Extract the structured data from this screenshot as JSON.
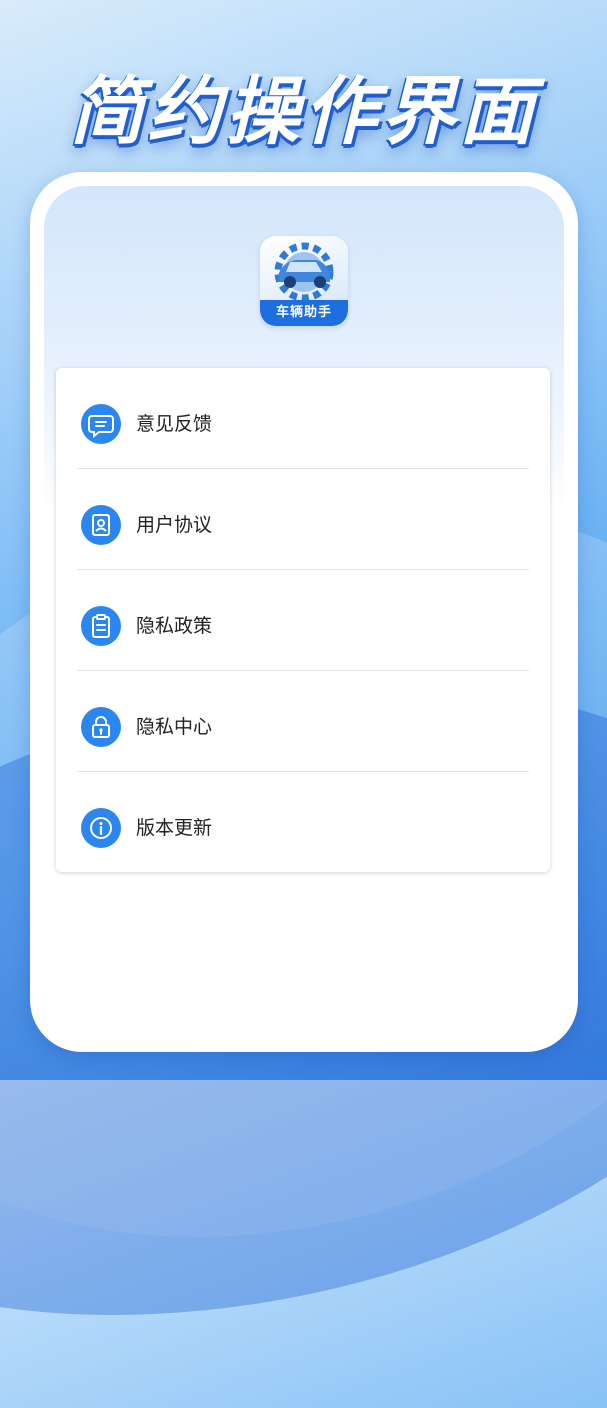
{
  "headline": "简约操作界面",
  "app": {
    "name": "车辆助手",
    "accent_color": "#1d6fe0"
  },
  "menu": {
    "items": [
      {
        "label": "意见反馈",
        "icon": "chat-bubble-icon"
      },
      {
        "label": "用户协议",
        "icon": "document-user-icon"
      },
      {
        "label": "隐私政策",
        "icon": "clipboard-icon"
      },
      {
        "label": "隐私中心",
        "icon": "lock-icon"
      },
      {
        "label": "版本更新",
        "icon": "info-icon"
      }
    ]
  }
}
